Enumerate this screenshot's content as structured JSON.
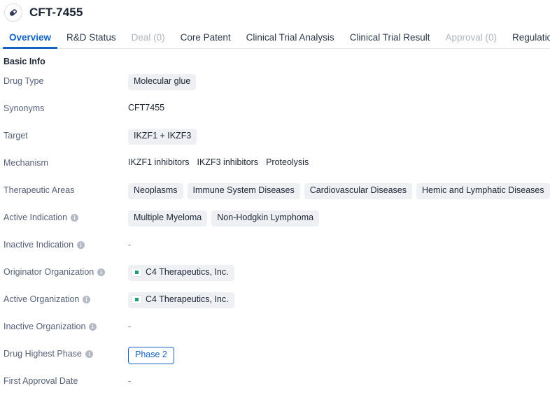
{
  "header": {
    "icon": "pill-capsule-icon",
    "title": "CFT-7455"
  },
  "tabs": [
    {
      "label": "Overview",
      "state": "active"
    },
    {
      "label": "R&D Status",
      "state": "normal"
    },
    {
      "label": "Deal (0)",
      "state": "disabled"
    },
    {
      "label": "Core Patent",
      "state": "normal"
    },
    {
      "label": "Clinical Trial Analysis",
      "state": "normal"
    },
    {
      "label": "Clinical Trial Result",
      "state": "normal"
    },
    {
      "label": "Approval (0)",
      "state": "disabled"
    },
    {
      "label": "Regulation",
      "state": "normal"
    }
  ],
  "section": {
    "title": "Basic Info"
  },
  "rows": [
    {
      "label": "Drug Type",
      "has_info_icon": false,
      "type": "chips",
      "values": [
        "Molecular glue"
      ]
    },
    {
      "label": "Synonyms",
      "has_info_icon": false,
      "type": "text",
      "values": [
        "CFT7455"
      ]
    },
    {
      "label": "Target",
      "has_info_icon": false,
      "type": "chips",
      "values": [
        "IKZF1 + IKZF3"
      ]
    },
    {
      "label": "Mechanism",
      "has_info_icon": false,
      "type": "text-list",
      "values": [
        "IKZF1 inhibitors",
        "IKZF3 inhibitors",
        "Proteolysis"
      ]
    },
    {
      "label": "Therapeutic Areas",
      "has_info_icon": false,
      "type": "chips",
      "values": [
        "Neoplasms",
        "Immune System Diseases",
        "Cardiovascular Diseases",
        "Hemic and Lymphatic Diseases"
      ]
    },
    {
      "label": "Active Indication",
      "has_info_icon": true,
      "type": "chips",
      "values": [
        "Multiple Myeloma",
        "Non-Hodgkin Lymphoma"
      ]
    },
    {
      "label": "Inactive Indication",
      "has_info_icon": true,
      "type": "empty",
      "values": [
        "-"
      ]
    },
    {
      "label": "Originator Organization",
      "has_info_icon": true,
      "type": "org-chips",
      "values": [
        "C4 Therapeutics, Inc."
      ]
    },
    {
      "label": "Active Organization",
      "has_info_icon": true,
      "type": "org-chips",
      "values": [
        "C4 Therapeutics, Inc."
      ]
    },
    {
      "label": "Inactive Organization",
      "has_info_icon": true,
      "type": "empty",
      "values": [
        "-"
      ]
    },
    {
      "label": "Drug Highest Phase",
      "has_info_icon": true,
      "type": "phase-badge",
      "values": [
        "Phase 2"
      ]
    },
    {
      "label": "First Approval Date",
      "has_info_icon": false,
      "type": "empty",
      "values": [
        "-"
      ]
    }
  ],
  "colors": {
    "accent": "#1563c0",
    "label_text": "#57617a",
    "value_text": "#1c2535",
    "chip_bg": "#eff0f3",
    "disabled_tab": "#aeb4bf",
    "org_logo_mark": "#16a07a"
  }
}
